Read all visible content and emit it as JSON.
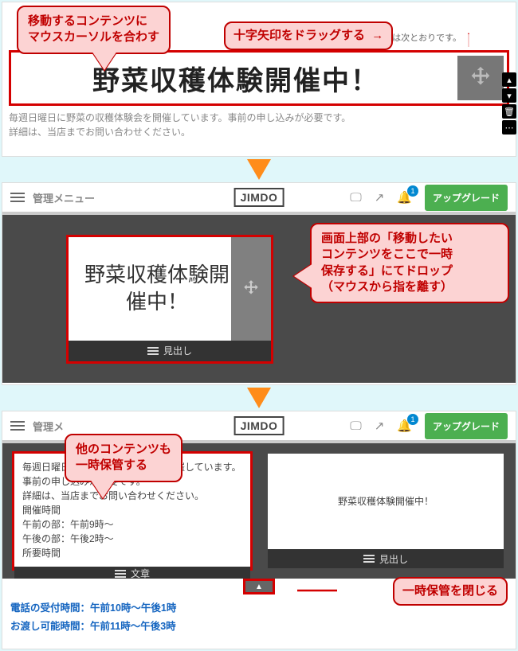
{
  "panel1": {
    "callout_hover": "移動するコンテンツに\nマウスカーソルを合わす",
    "callout_drag": "十字矢印をドラッグする",
    "bg_tail_text": "テイクアウトの営業時間は次とおりです。",
    "heading": "野菜収穫体験開催中！",
    "desc_line1": "毎週日曜日に野菜の収穫体験会を開催しています。事前の申し込みが必要です。",
    "desc_line2": "詳細は、当店までお問い合わせください。"
  },
  "toolbar": {
    "menu_label": "管理メニュー",
    "logo": "JIMDO",
    "notification_count": "1",
    "upgrade_label": "アップグレード"
  },
  "panel2": {
    "callout_drop": "画面上部の「移動したい\nコンテンツをここで一時\n保存する」にてドロップ\n（マウスから指を離す）",
    "card_title": "野菜収穫体験開催中！",
    "card_foot_label": "見出し"
  },
  "panel3": {
    "callout_store": "他のコンテンツも\n一時保管する",
    "callout_close": "一時保管を閉じる",
    "card_text_lines": [
      "毎週日曜日に野菜の収穫体験会を開催しています。事前の申し込みが必要です。",
      "詳細は、当店までお問い合わせください。",
      "開催時間",
      "午前の部：午前9時～",
      "午後の部：午後2時～",
      "所要時間"
    ],
    "card_text_foot": "文章",
    "card_head_title": "野菜収穫体験開催中！",
    "card_head_foot": "見出し",
    "phone_line": "電話の受付時間：午前10時～午後1時",
    "pickup_line": "お渡し可能時間：午前11時～午後3時"
  },
  "toolbar2": {
    "menu_label": "管理メ"
  }
}
